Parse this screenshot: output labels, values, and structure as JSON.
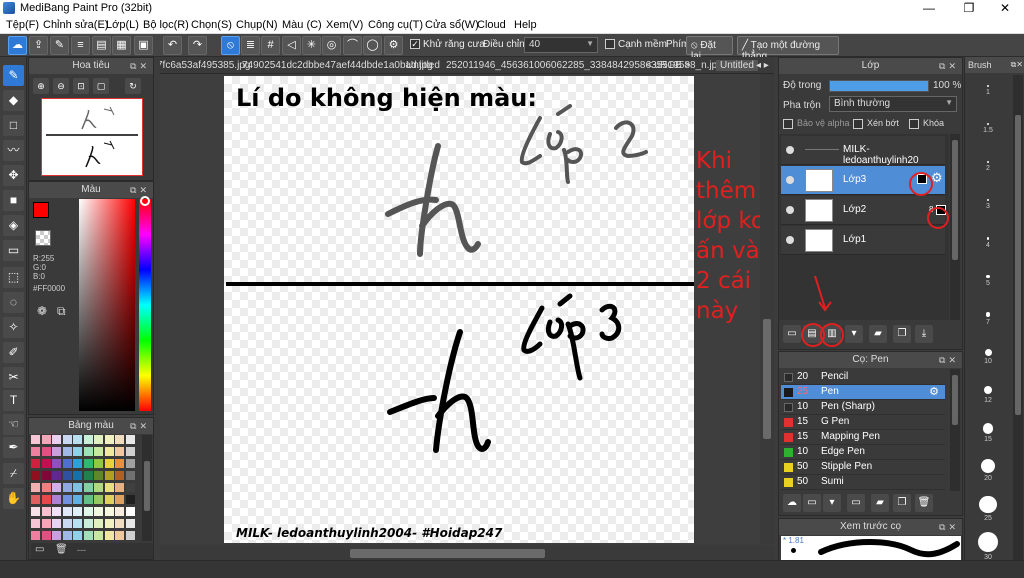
{
  "window": {
    "title": "MediBang Paint Pro (32bit)",
    "minimize": "—",
    "maximize": "❐",
    "close": "✕"
  },
  "menu": [
    "Tệp(F)",
    "Chỉnh sửa(E)",
    "Lớp(L)",
    "Bộ lọc(R)",
    "Chọn(S)",
    "Chụp(N)",
    "Màu (C)",
    "Xem(V)",
    "Công cụ(T)",
    "Cửa sổ(W)",
    "Cloud",
    "Help"
  ],
  "toolbar": {
    "antialias_label": "Khử răng cưa",
    "adjust_label": "Điều chỉnh",
    "adjust_value": "40",
    "smooth_label": "Cạnh mềm",
    "key_label": "Phím",
    "reset_label": "Đặt lại",
    "line_label": "Tạo một đường thẳng"
  },
  "navigator": {
    "title": "Hoa tiêu"
  },
  "color_panel": {
    "title": "Màu",
    "r": "R:255",
    "g": "G:0",
    "b": "B:0",
    "hex": "#FF0000",
    "primary": "#ff0000"
  },
  "palette_panel": {
    "title": "Bảng màu",
    "footer": "---",
    "colors": [
      "#f7c6d6",
      "#f4a6b8",
      "#e8d2f0",
      "#c9d8f0",
      "#b8e0f0",
      "#c8f0d8",
      "#e0f0c0",
      "#f0f0c0",
      "#f0dcc0",
      "#e8e8e8",
      "#ef7fa0",
      "#e05080",
      "#c8a0e0",
      "#a0b8e8",
      "#90d0e8",
      "#a0e0b8",
      "#c8e8a0",
      "#f0e8a0",
      "#f0c8a0",
      "#d0d0d0",
      "#d02040",
      "#c01050",
      "#9050c0",
      "#5070d0",
      "#30a0d8",
      "#30b870",
      "#90c840",
      "#e8d040",
      "#e89040",
      "#a0a0a0",
      "#901020",
      "#800838",
      "#602890",
      "#3050a0",
      "#1870a8",
      "#208050",
      "#608828",
      "#b0a020",
      "#b06020",
      "#707070",
      "#f0b0b0",
      "#f08080",
      "#d0b0e8",
      "#90a8e0",
      "#80c0e0",
      "#80d0a0",
      "#b0d880",
      "#e8e080",
      "#e8b080",
      "#404040",
      "#e06060",
      "#e84848",
      "#b080d8",
      "#7090e0",
      "#60b0e0",
      "#60c088",
      "#98c860",
      "#e0d060",
      "#e0a060",
      "#202020",
      "#f8e0e8",
      "#f8c0d0",
      "#f0e0f8",
      "#e0e8f8",
      "#e0f0f8",
      "#e0f8e8",
      "#f0f8e0",
      "#f8f8e0",
      "#f8ece0",
      "#ffffff"
    ]
  },
  "doc_tabs": [
    "7fc6a53af495385.jpg",
    "74902541dc2dbbe47aef44dbde1a0bad.jpg",
    "Untitled",
    "252011946_456361006062285_3384842958635519588_n.jpg",
    "< uRGB >",
    "Untitled"
  ],
  "canvas": {
    "heading": "Lí do không hiện màu:",
    "label_layer2": "Lớp 2",
    "label_layer3": "Lớp 3",
    "stroke_letter": "h",
    "footer": "MILK- ledoanthuylinh2004- #Hoidap247",
    "annotation": [
      "Khi",
      "thêm",
      "lớp ko",
      "ấn vào",
      "2 cái",
      "này"
    ]
  },
  "layer_panel": {
    "title": "Lớp",
    "opacity_label": "Độ trong",
    "opacity_value": "100 %",
    "opacity_fraction": 1.0,
    "blend_label": "Pha trộn",
    "blend_value": "Bình thường",
    "protect_alpha": "Bảo vệ alpha",
    "clipping": "Xén bớt",
    "lock": "Khóa",
    "layers": [
      {
        "name": "MILK- ledoanthuylinh20",
        "selected": false
      },
      {
        "name": "Lớp3",
        "selected": true
      },
      {
        "name": "Lớp2",
        "selected": false
      },
      {
        "name": "Lớp1",
        "selected": false
      }
    ],
    "layer2_badge": "8"
  },
  "brush_panel": {
    "title": "Cọ: Pen",
    "brushes": [
      {
        "size": "20",
        "name": "Pencil",
        "color": "#2a2a2a",
        "selected": false
      },
      {
        "size": "25",
        "name": "Pen",
        "color": "#1a1a1a",
        "selected": true
      },
      {
        "size": "10",
        "name": "Pen (Sharp)",
        "color": "#2a2a2a",
        "selected": false
      },
      {
        "size": "15",
        "name": "G Pen",
        "color": "#e03030",
        "selected": false
      },
      {
        "size": "15",
        "name": "Mapping Pen",
        "color": "#e03030",
        "selected": false
      },
      {
        "size": "10",
        "name": "Edge Pen",
        "color": "#30b030",
        "selected": false
      },
      {
        "size": "50",
        "name": "Stipple Pen",
        "color": "#e8d020",
        "selected": false
      },
      {
        "size": "50",
        "name": "Sumi",
        "color": "#e8d020",
        "selected": false
      }
    ]
  },
  "preview_panel": {
    "title": "Xem trước cọ",
    "size_readout": "* 1.81"
  },
  "brush_size_panel": {
    "title": "Brush",
    "sizes": [
      "1",
      "1.5",
      "2",
      "3",
      "4",
      "5",
      "7",
      "10",
      "12",
      "15",
      "20",
      "25",
      "30"
    ]
  }
}
